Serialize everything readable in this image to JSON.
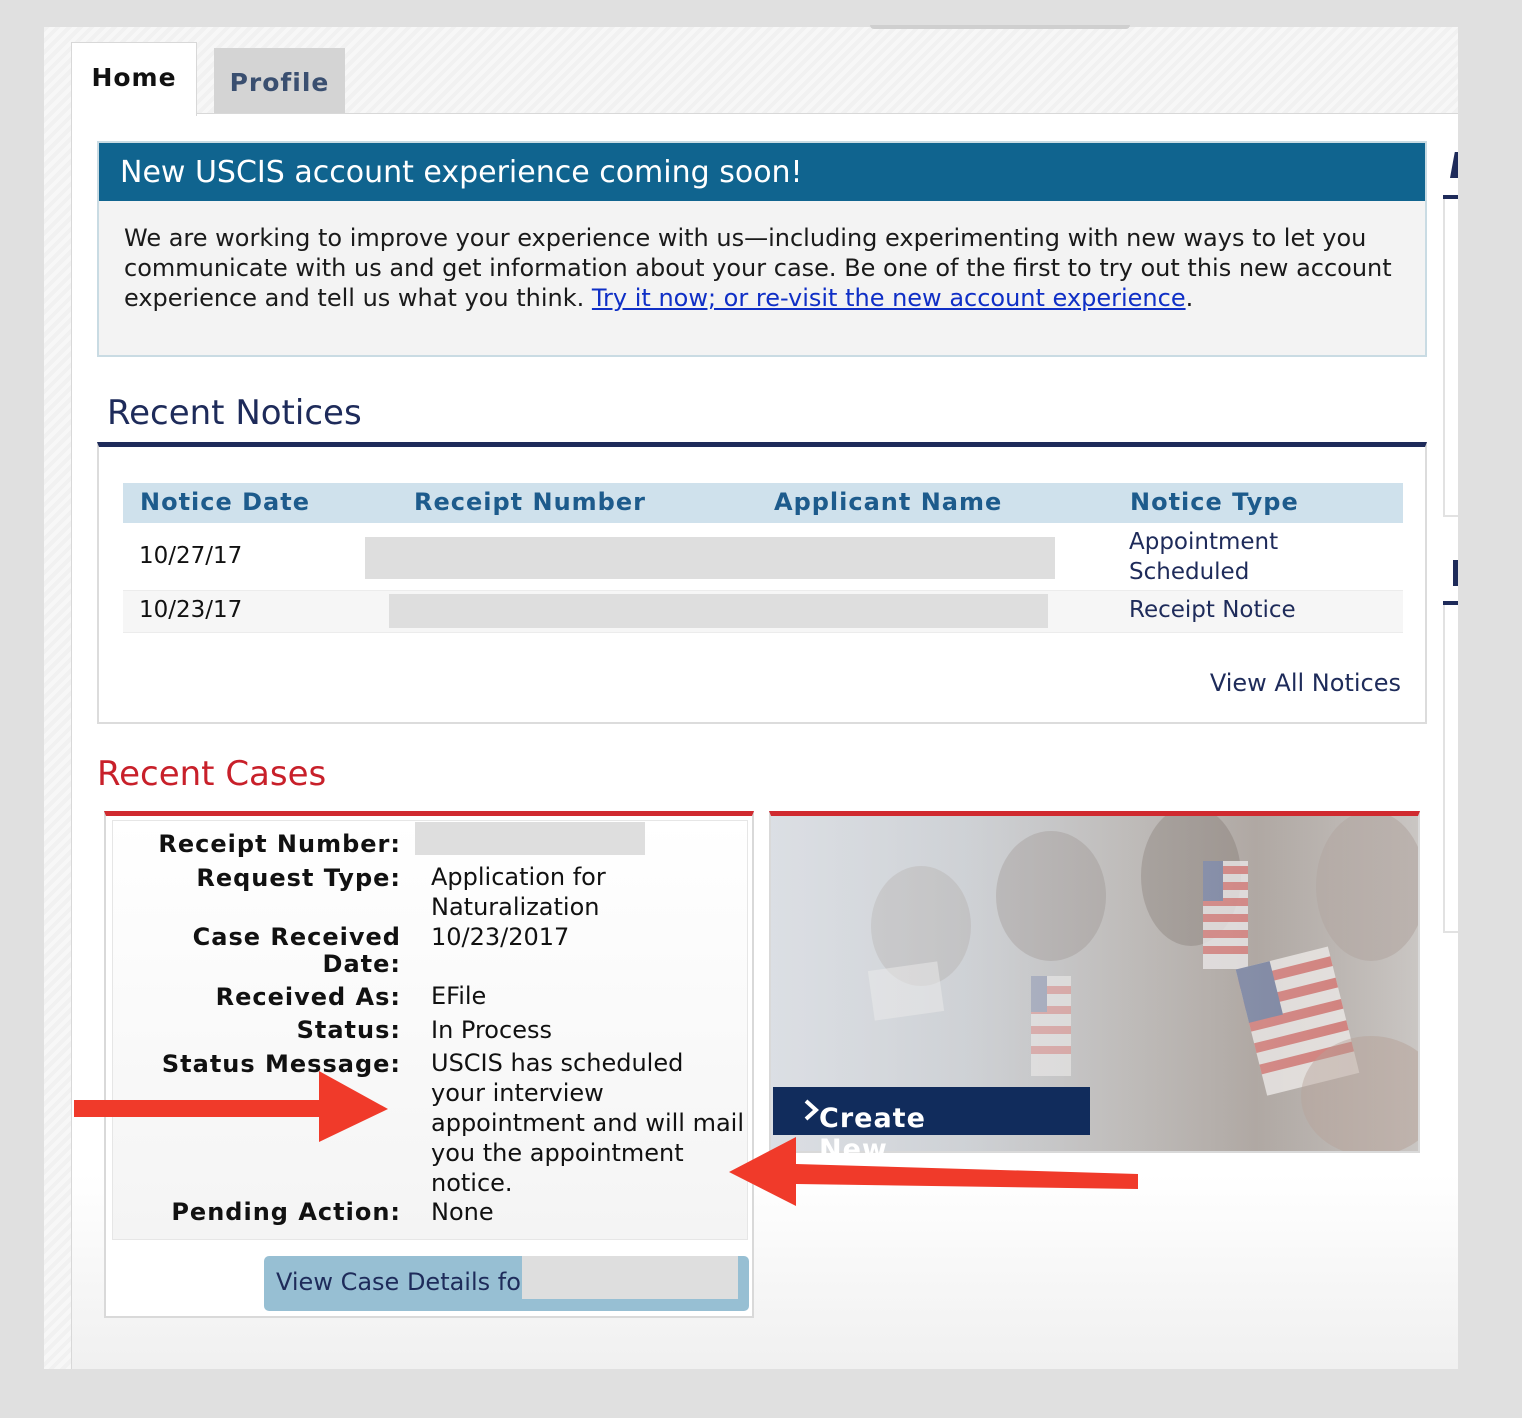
{
  "tabs": [
    {
      "label": "Home",
      "active": true
    },
    {
      "label": "Profile",
      "active": false
    }
  ],
  "banner": {
    "title": "New USCIS account experience coming soon!",
    "body_line1": "We are working to improve your experience with us—including experimenting with new ways to let you",
    "body_line2": "communicate with us and get information about your case. Be one of the first to try out this new account",
    "body_line3": "experience and tell us what you think.",
    "link_text": "Try it now; or re-visit the new account experience",
    "period": "."
  },
  "recent_notices": {
    "title": "Recent Notices",
    "columns": [
      "Notice Date",
      "Receipt Number",
      "Applicant Name",
      "Notice Type"
    ],
    "rows": [
      {
        "date": "10/27/17",
        "type_line1": "Appointment",
        "type_line2": "Scheduled"
      },
      {
        "date": "10/23/17",
        "type_line1": "Receipt Notice",
        "type_line2": ""
      }
    ],
    "view_all": "View All Notices"
  },
  "recent_cases": {
    "title": "Recent Cases",
    "labels": {
      "receipt_number": "Receipt Number:",
      "request_type": "Request Type:",
      "case_received_1": "Case Received",
      "case_received_2": "Date:",
      "received_as": "Received As:",
      "status": "Status:",
      "status_message": "Status Message:",
      "pending_action": "Pending Action:"
    },
    "values": {
      "request_type_1": "Application for",
      "request_type_2": "Naturalization",
      "case_received": "10/23/2017",
      "received_as": "EFile",
      "status": "In Process",
      "status_message_1": "USCIS has scheduled",
      "status_message_2": "your interview",
      "status_message_3": "appointment and will mail",
      "status_message_4": "you the appointment",
      "status_message_5": "notice.",
      "pending_action": "None"
    },
    "view_details": "View Case Details for",
    "create_new_case": "Create New Case",
    "create_icon": "chevron-right-icon"
  },
  "colors": {
    "banner_blue": "#10648f",
    "navy": "#1e2b5a",
    "cases_red": "#c8202a",
    "arrow_red": "#f03a2a"
  }
}
